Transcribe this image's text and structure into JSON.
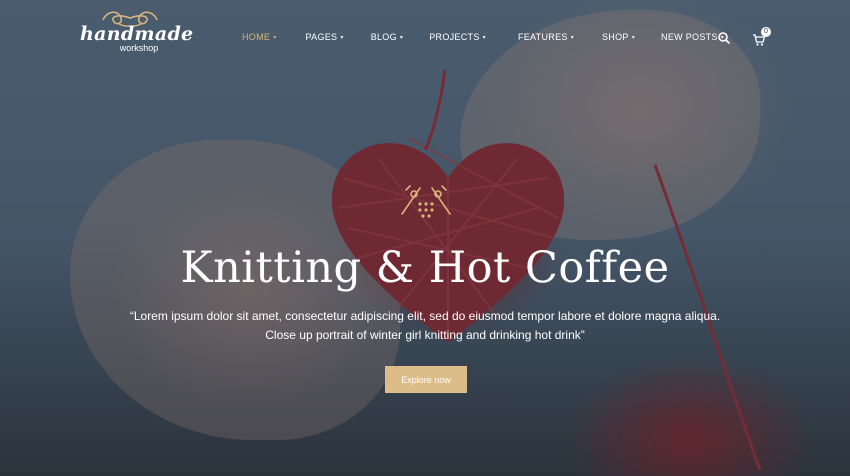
{
  "brand": {
    "name": "handmade",
    "tagline": "workshop",
    "flourish_icon": "scroll-flourish-icon"
  },
  "nav": {
    "items": [
      {
        "label": "HOME",
        "active": true
      },
      {
        "label": "PAGES",
        "active": false
      },
      {
        "label": "BLOG",
        "active": false
      },
      {
        "label": "PROJECTS",
        "active": false
      },
      {
        "label": "FEATURES",
        "active": false
      },
      {
        "label": "SHOP",
        "active": false
      },
      {
        "label": "NEW POSTS",
        "active": false
      }
    ],
    "dropdown_icon": "chevron-down-icon",
    "search_icon": "search-icon",
    "cart_icon": "cart-icon",
    "cart_count": "0"
  },
  "hero": {
    "icon": "knitting-needles-icon",
    "title": "Knitting & Hot Coffee",
    "text": "“Lorem ipsum dolor sit amet, consectetur adipiscing elit, sed do eiusmod tempor labore et dolore magna aliqua. Close up portrait of winter girl knitting and drinking hot drink”",
    "cta_label": "Explore now"
  },
  "colors": {
    "accent": "#dcbd87",
    "active_nav": "#d8b57d",
    "text": "#ffffff",
    "overlay": "#2a3a4a"
  }
}
